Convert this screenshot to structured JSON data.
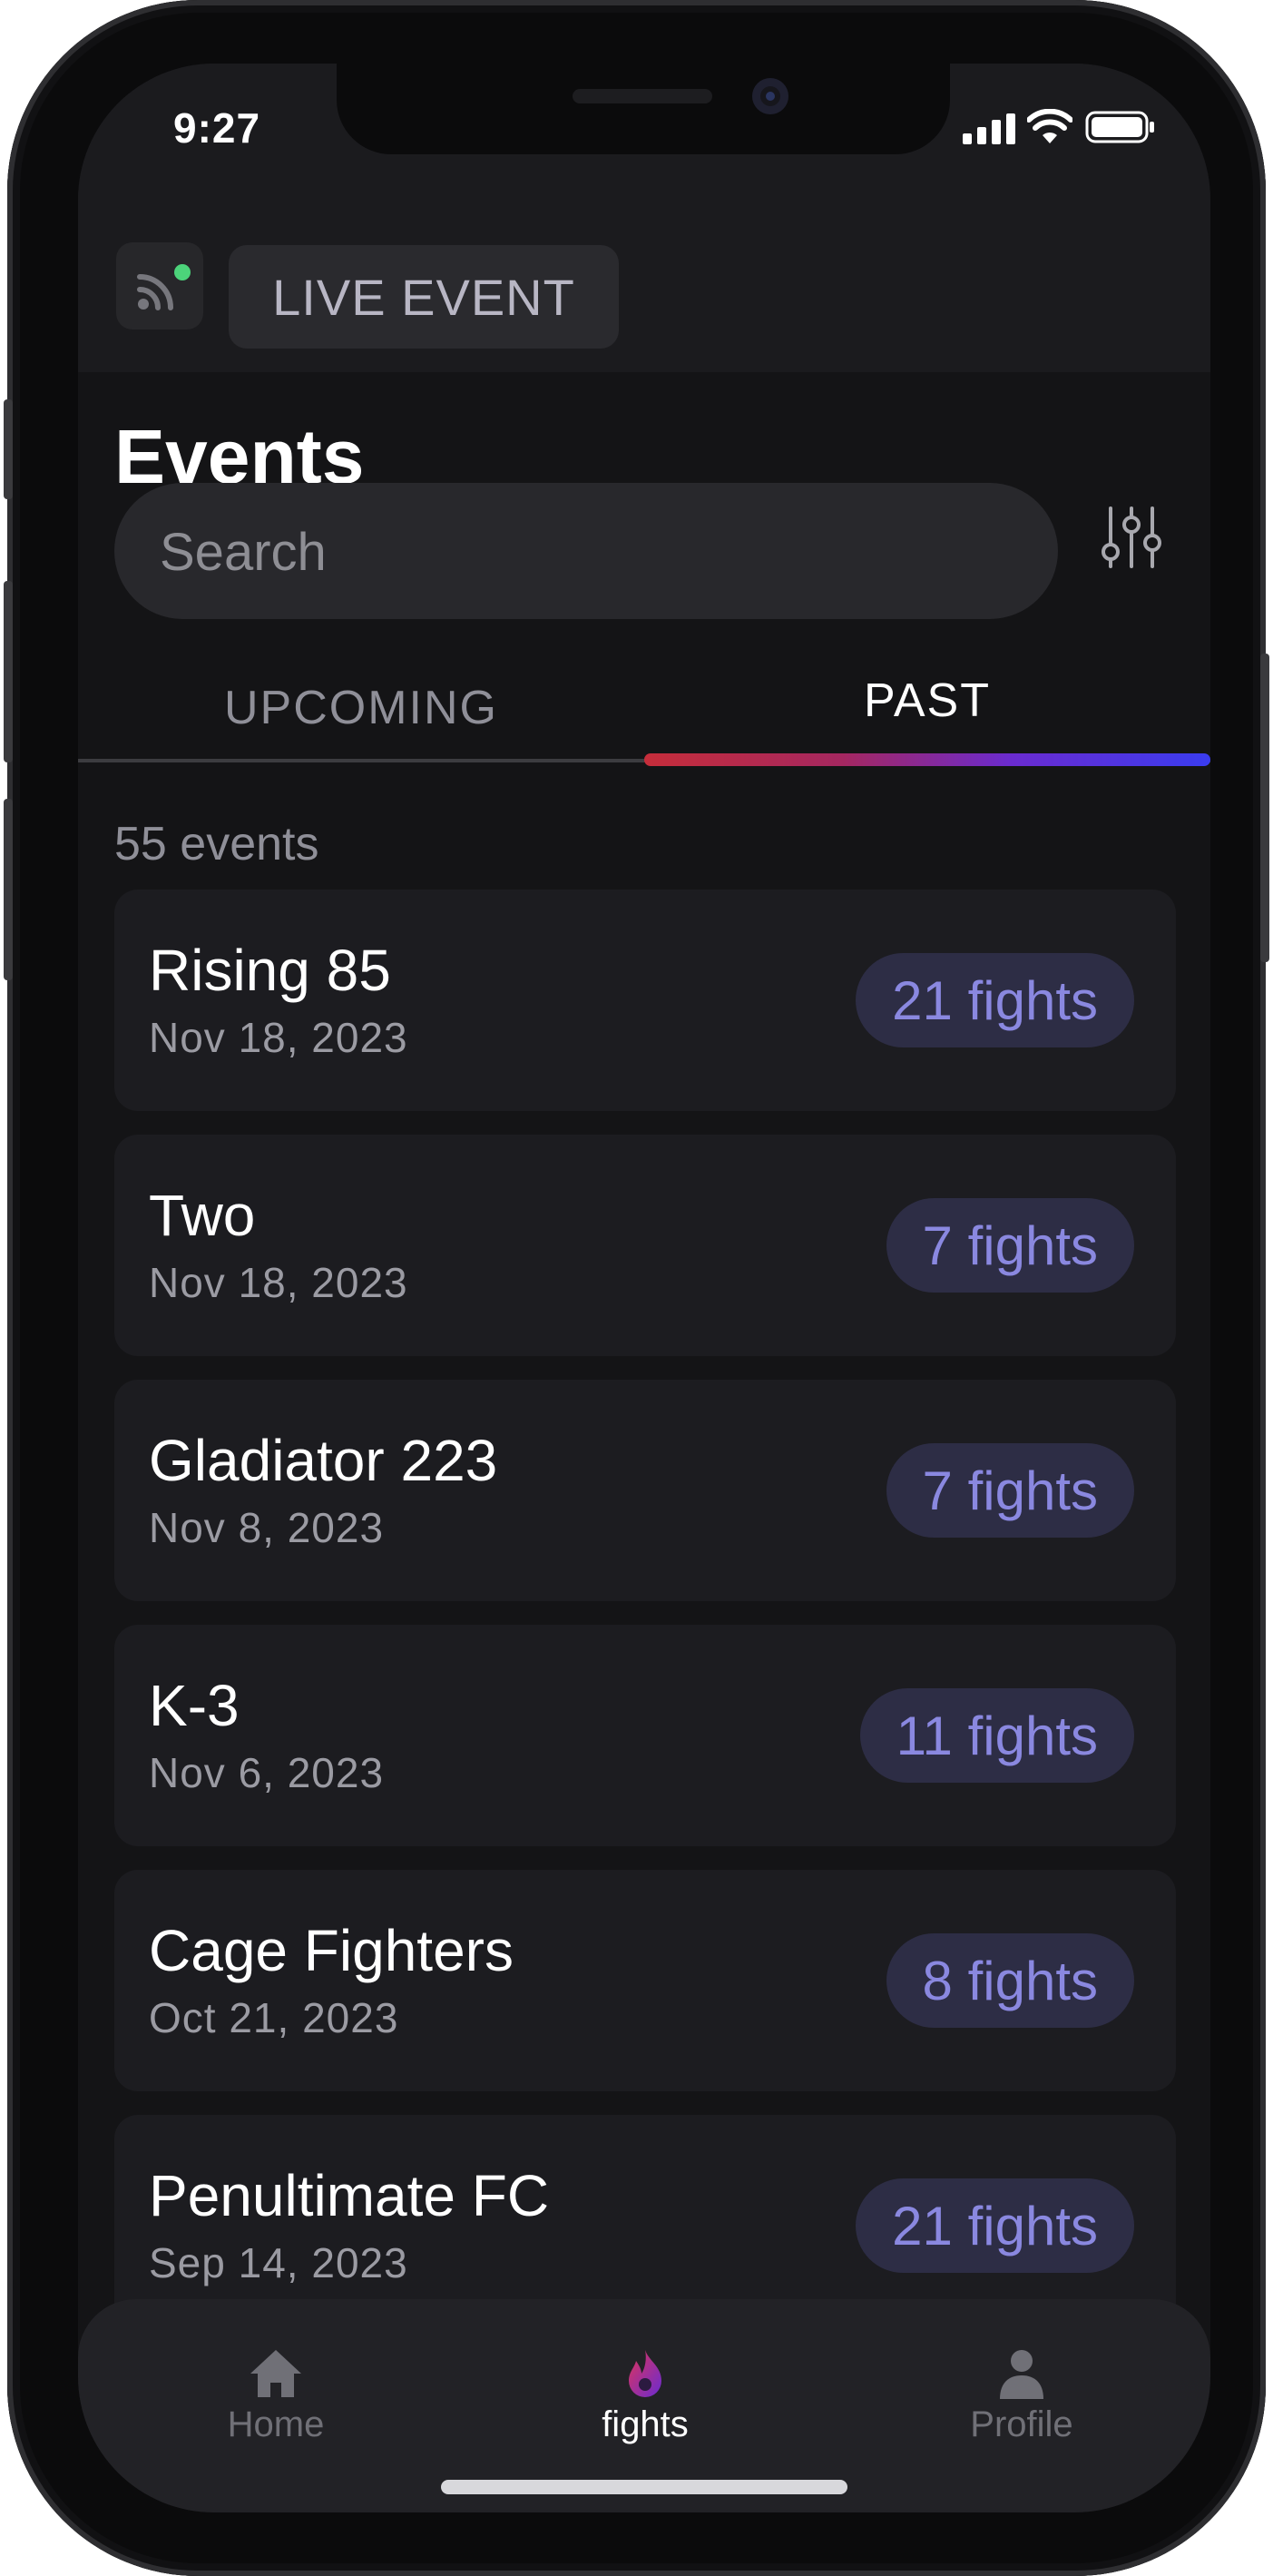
{
  "status_bar": {
    "time": "9:27"
  },
  "top_bar": {
    "live_event_label": "LIVE EVENT"
  },
  "page": {
    "title": "Events"
  },
  "search": {
    "placeholder": "Search",
    "value": ""
  },
  "tabs": [
    {
      "label": "UPCOMING",
      "active": false
    },
    {
      "label": "PAST",
      "active": true
    }
  ],
  "events_count_label": "55 events",
  "events": [
    {
      "name": "Rising 85",
      "date": "Nov 18, 2023",
      "fights": "21 fights"
    },
    {
      "name": "Two",
      "date": "Nov 18, 2023",
      "fights": "7 fights"
    },
    {
      "name": "Gladiator 223",
      "date": "Nov 8, 2023",
      "fights": "7 fights"
    },
    {
      "name": "K-3",
      "date": "Nov 6, 2023",
      "fights": "11 fights"
    },
    {
      "name": "Cage Fighters",
      "date": "Oct 21, 2023",
      "fights": "8 fights"
    },
    {
      "name": "Penultimate FC",
      "date": "Sep 14, 2023",
      "fights": "21 fights"
    }
  ],
  "bottom_nav": [
    {
      "label": "Home",
      "icon": "home-icon",
      "active": false
    },
    {
      "label": "fights",
      "icon": "flame-icon",
      "active": true
    },
    {
      "label": "Profile",
      "icon": "person-icon",
      "active": false
    }
  ],
  "colors": {
    "accent_badge_text": "#8a88e0",
    "live_indicator": "#4cd37a",
    "tab_indicator_start": "#c62d3a",
    "tab_indicator_end": "#3a3cf0"
  }
}
